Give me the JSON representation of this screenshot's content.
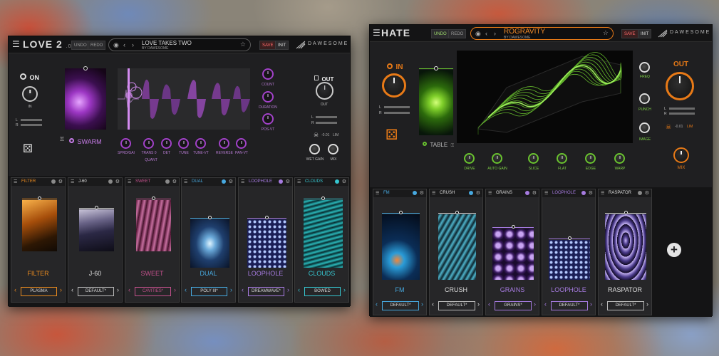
{
  "love2": {
    "logo": "LOVE 2",
    "version": ".02",
    "undo": "UNDO",
    "redo": "REDO",
    "preset_name": "LOVE TAKES TWO",
    "preset_author": "BY DAWESOME",
    "save": "SAVE",
    "init": "INIT",
    "brand": "DAWESOME",
    "on_label": "ON",
    "in_label": "IN",
    "out_label": "OUT",
    "out_knob_label": "OUT",
    "meter_l": "L",
    "meter_r": "R",
    "db_value": "-0.01",
    "lim": "LIM",
    "engine": "SWARM",
    "side_knobs": [
      "COUNT",
      "DURATION",
      "POS-VT"
    ],
    "bottom_knobs": [
      "SPRD/GAI",
      "TRANS 0",
      "DET",
      "TUNE",
      "TUNE-VT",
      "REVERSE",
      "PAN-VT"
    ],
    "quant": "QUANT",
    "wet_gain": "WET GAIN",
    "mix": "MIX",
    "slots": [
      {
        "tag": "FILTER",
        "title": "FILTER",
        "preset": "PLASMA",
        "color": "#e88a1f"
      },
      {
        "tag": "J-60",
        "title": "J-60",
        "preset": "DEFAULT*",
        "color": "#dddddd"
      },
      {
        "tag": "SWEET",
        "title": "SWEET",
        "preset": "CAVITIES*",
        "color": "#c1508b"
      },
      {
        "tag": "DUAL",
        "title": "DUAL",
        "preset": "POLY III*",
        "color": "#47a9e0"
      },
      {
        "tag": "LOOPHOLE",
        "title": "LOOPHOLE",
        "preset": "DREAMWAVE*",
        "color": "#a67be0"
      },
      {
        "tag": "CLOUDS",
        "title": "CLOUDS",
        "preset": "BOWED",
        "color": "#36c6d0"
      }
    ]
  },
  "hate": {
    "logo": "HATE",
    "undo": "UNDO",
    "redo": "REDO",
    "preset_name": "ROGRAVITY",
    "preset_author": "BY DAWESOME",
    "save": "SAVE",
    "init": "INIT",
    "brand": "DAWESOME",
    "in_label": "IN",
    "out_label": "OUT",
    "meter_l": "L",
    "meter_r": "R",
    "db_value": "-0.01",
    "lim": "LIM",
    "table": "TABLE",
    "right_knobs": [
      "FREQ",
      "PUNCH",
      "IMAGE"
    ],
    "bottom_knobs": [
      "DRIVE",
      "AUTO GAIN",
      "SLICE",
      "FLAT",
      "EDGE",
      "WARP"
    ],
    "mix": "MIX",
    "slots": [
      {
        "tag": "FM",
        "title": "FM",
        "preset": "DEFAULT*",
        "color": "#47a9e0"
      },
      {
        "tag": "CRUSH",
        "title": "CRUSH",
        "preset": "DEFAULT*",
        "color": "#dddddd"
      },
      {
        "tag": "GRAINS",
        "title": "GRAINS",
        "preset": "GRAINS*",
        "color": "#a67be0"
      },
      {
        "tag": "LOOPHOLE",
        "title": "LOOPHOLE",
        "preset": "DEFAULT*",
        "color": "#a67be0"
      },
      {
        "tag": "RASPATOR",
        "title": "RASPATOR",
        "preset": "DEFAULT*",
        "color": "#dddddd"
      }
    ]
  },
  "colors": {
    "purple": "#a242c9",
    "green": "#69c22f",
    "orange": "#e87a17"
  }
}
